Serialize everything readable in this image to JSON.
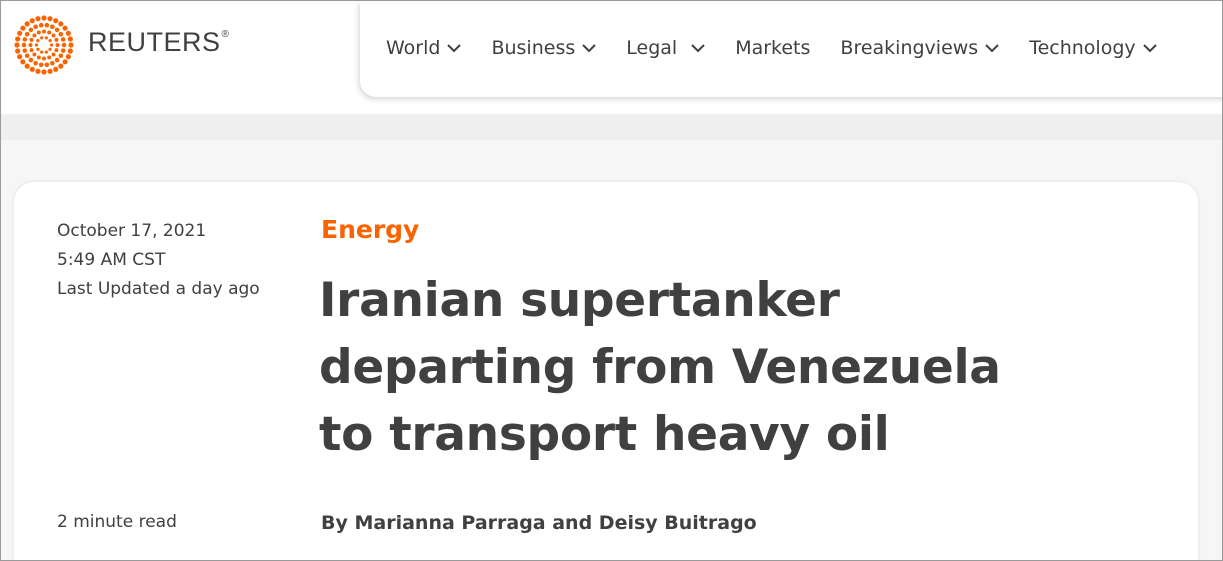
{
  "brand": {
    "name": "REUTERS",
    "registered": "®",
    "accent": "#fa6400"
  },
  "nav": {
    "items": [
      {
        "label": "World",
        "dropdown": true
      },
      {
        "label": "Business",
        "dropdown": true
      },
      {
        "label": "Legal",
        "dropdown": true
      },
      {
        "label": "Markets",
        "dropdown": false
      },
      {
        "label": "Breakingviews",
        "dropdown": true
      },
      {
        "label": "Technology",
        "dropdown": true
      }
    ]
  },
  "article": {
    "date": "October 17, 2021",
    "time": "5:49 AM CST",
    "updated": "Last Updated a day ago",
    "read_time": "2 minute read",
    "section": "Energy",
    "headline": "Iranian supertanker departing from Venezuela to transport heavy oil",
    "byline": "By Marianna Parraga and Deisy Buitrago"
  }
}
